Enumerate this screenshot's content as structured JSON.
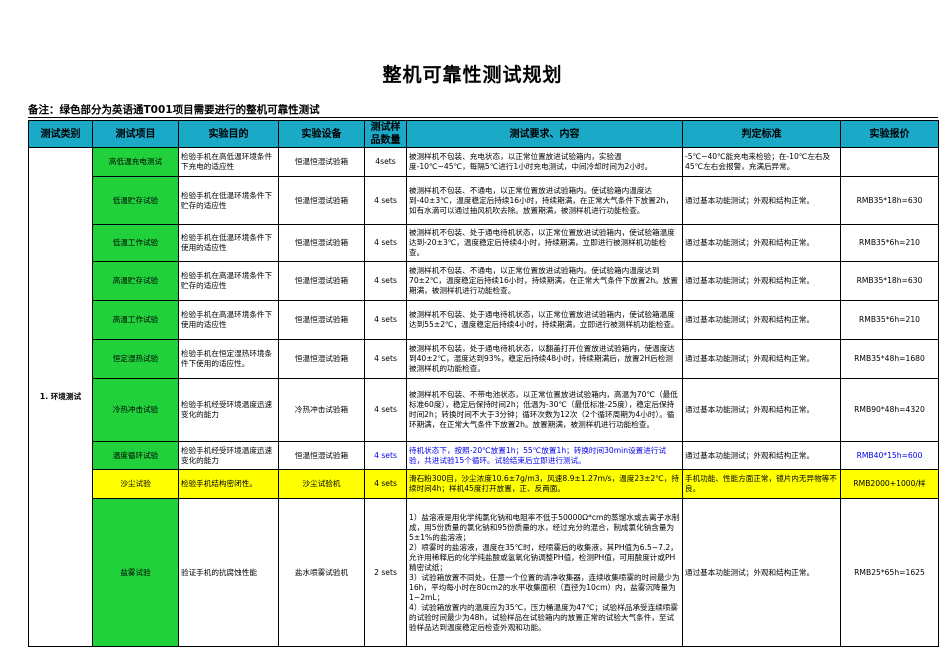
{
  "title": "整机可靠性测试规划",
  "note": "备注：绿色部分为英语通T001项目需要进行的整机可靠性测试",
  "headers": [
    "测试类别",
    "测试项目",
    "实验目的",
    "实验设备",
    "测试样品数量",
    "测试要求、内容",
    "判定标准",
    "实验报价"
  ],
  "category": "1. 环境测试",
  "rows": [
    {
      "item": "高低温充电测试",
      "purpose": "检验手机在高低温环境条件下充电的适应性",
      "equipment": "恒温恒湿试验箱",
      "qty": "4sets",
      "requirement": "被测样机不包装、充电状态，以正常位置放进试验箱内，实验温度-10℃~45℃，每隔5℃进行1小时充电测试，中间冷却时间为2小时。",
      "judgement": "-5℃~40℃能充电来检验；在-10℃左右及45℃左右会报警，充满后异常。",
      "price": ""
    },
    {
      "item": "低温贮存试验",
      "purpose": "检验手机在低温环境条件下贮存的适应性",
      "equipment": "恒温恒湿试验箱",
      "qty": "4 sets",
      "requirement": "被测样机不包装、不通电，以正常位置放进试验箱内。使试验箱内温度达到-40±3℃，温度稳定后持续16小时，持续期满，在正常大气条件下放置2h，如有水滴可以通过抽风机吹去除。放置期满，被测样机进行功能检查。",
      "judgement": "通过基本功能测试；外观和结构正常。",
      "price": "RMB35*18h=630"
    },
    {
      "item": "低温工作试验",
      "purpose": "检验手机在低温环境条件下使用的适应性",
      "equipment": "恒温恒湿试验箱",
      "qty": "4 sets",
      "requirement": "被测样机不包装、处于通电待机状态，以正常位置放进试验箱内，使试验箱温度达到-20±3℃，温度稳定后持续4小时，持续期满，立即进行被测样机功能检查。",
      "judgement": "通过基本功能测试；外观和结构正常。",
      "price": "RMB35*6h=210"
    },
    {
      "item": "高温贮存试验",
      "purpose": "检验手机在高温环境条件下贮存的适应性",
      "equipment": "恒温恒湿试验箱",
      "qty": "4 sets",
      "requirement": "被测样机不包装、不通电，以正常位置放进试验箱内。使试验箱内温度达到70±2℃，温度稳定后持续16小时，持续期满，在正常大气条件下放置2h。放置期满，被测样机进行功能检查。",
      "judgement": "通过基本功能测试；外观和结构正常。",
      "price": "RMB35*18h=630"
    },
    {
      "item": "高温工作试验",
      "purpose": "检验手机在高温环境条件下使用的适应性",
      "equipment": "恒温恒湿试验箱",
      "qty": "4 sets",
      "requirement": "被测样机不包装、处于通电待机状态，以正常位置放进试验箱内，使试验箱温度达到55±2℃，温度稳定后持续4小时，持续期满，立即进行被测样机功能检查。",
      "judgement": "通过基本功能测试；外观和结构正常。",
      "price": "RMB35*6h=210"
    },
    {
      "item": "恒定湿热试验",
      "purpose": "检验手机在恒定湿热环境条件下使用的适应性。",
      "equipment": "恒温恒湿试验箱",
      "qty": "4 sets",
      "requirement": "被测样机不包装，处于通电待机状态，以翻盖打开位置放进试验箱内，使温度达到40±2℃，湿度达到93%，稳定后持续48小时，持续期满后，放置2H后检测被测样机的功能检查。",
      "judgement": "通过基本功能测试；外观和结构正常。",
      "price": "RMB35*48h=1680"
    },
    {
      "item": "冷热冲击试验",
      "purpose": "检验手机经受环境温度迅速变化的能力",
      "equipment": "冷热冲击试验箱",
      "qty": "4 sets",
      "requirement": "被测样机不包装、不带电池状态，以正常位置放进试验箱内，高温为70℃（最低标准60度），稳定后保持时间2h；低温为-30℃（最低标准-25度），稳定后保持时间2h；转换时间不大于3分钟；循环次数为12次（2个循环周期为4小时）。循环期满，在正常大气条件下放置2h。放置期满，被测样机进行功能检查。",
      "judgement": "通过基本功能测试；外观和结构正常。",
      "price": "RMB90*48h=4320"
    },
    {
      "item": "温度循环试验",
      "purpose": "检验手机经受环境温度迅速变化的能力",
      "equipment": "恒温恒湿试验箱",
      "qty": "4 sets",
      "requirement": "待机状态下，按照-20℃放置1h；55℃放置1h；转换时间30min设置进行试验，共进试验15个循环。试验结束后立即进行测试。",
      "judgement": "通过基本功能测试；外观和结构正常。",
      "price": "RMB40*15h=600"
    },
    {
      "item": "沙尘试验",
      "purpose": "检验手机结构密闭性。",
      "equipment": "沙尘试验机",
      "qty": "4 sets",
      "requirement": "滑石粉300目，沙尘浓度10.6±7g/m3，风速8.9±1.27m/s，温度23±2℃，持续时间4h；样机45度打开放置，正、反两面。",
      "judgement": "手机功能、性能方面正常，镜片内无异物等不良。",
      "price": "RMB2000+1000/样"
    },
    {
      "item": "盐雾试验",
      "purpose": "验证手机的抗腐蚀性能",
      "equipment": "盐水喷雾试验机",
      "qty": "2 sets",
      "requirement": "1）盐溶液是用化学纯氯化钠和电阻率不低于50000Ω*cm的蒸馏水或去离子水制成，用5份质量的氯化钠和95份质量的水，经过充分的混合，制成氯化钠含量为5±1%的盐溶液；\n2）喷雾时的盐溶液，温度在35℃时，经喷雾后的收集液，其PH值为6.5~7.2，允许用稀释后的化学纯盐酸或氢氧化钠调整PH值，检测PH值，可用酸度计或PH精密试纸；\n3）试验箱放置不同处，任意一个位置的清净收集器，连续收集喷雾的时间最少为16h，平均每小时在80cm2的水平收集面积（直径为10cm）内，盐雾沉降量为1~2mL；\n4）试验箱放置内的温度应为35℃，压力桶温度为47℃；试验样品承受连续喷雾的试验时间最少为48h，试验样品在试验箱内的放置正常的试验大气条件，至试验样品达到温度稳定后检查外观和功能。",
      "judgement": "通过基本功能测试；外观和结构正常。",
      "price": "RMB25*65h=1625"
    }
  ]
}
